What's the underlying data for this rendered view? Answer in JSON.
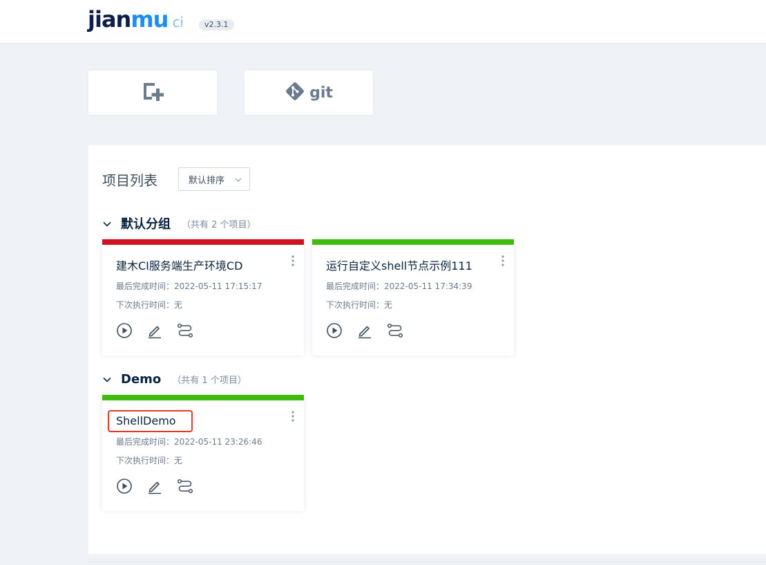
{
  "header": {
    "logo": {
      "part1": "jian",
      "part2": "mu",
      "part3": "ci"
    },
    "version": "v2.3.1"
  },
  "actions": {
    "new_project_icon": "new-project-icon",
    "git_icon": "git-icon",
    "git_label": "git"
  },
  "project_list": {
    "title": "项目列表",
    "sort": {
      "selected": "默认排序"
    }
  },
  "groups": [
    {
      "name": "默认分组",
      "count_text": "（共有 2 个项目）",
      "projects": [
        {
          "name": "建木CI服务端生产环境CD",
          "status_color": "#cf1322",
          "last_completed": "最后完成时间：2022-05-11 17:15:17",
          "next_run": "下次执行时间：无"
        },
        {
          "name": "运行自定义shell节点示例111",
          "status_color": "#3ebb0b",
          "last_completed": "最后完成时间：2022-05-11 17:34:39",
          "next_run": "下次执行时间：无"
        }
      ]
    },
    {
      "name": "Demo",
      "count_text": "（共有 1 个项目）",
      "projects": [
        {
          "name": "ShellDemo",
          "status_color": "#3ebb0b",
          "last_completed": "最后完成时间：2022-05-11 23:26:46",
          "next_run": "下次执行时间：无"
        }
      ]
    }
  ],
  "colors": {
    "failed": "#cf1322",
    "succeeded": "#3ebb0b",
    "highlight_box": "#e8362a",
    "brand_dark": "#0b1f4b",
    "brand_blue": "#1a8ef5"
  }
}
